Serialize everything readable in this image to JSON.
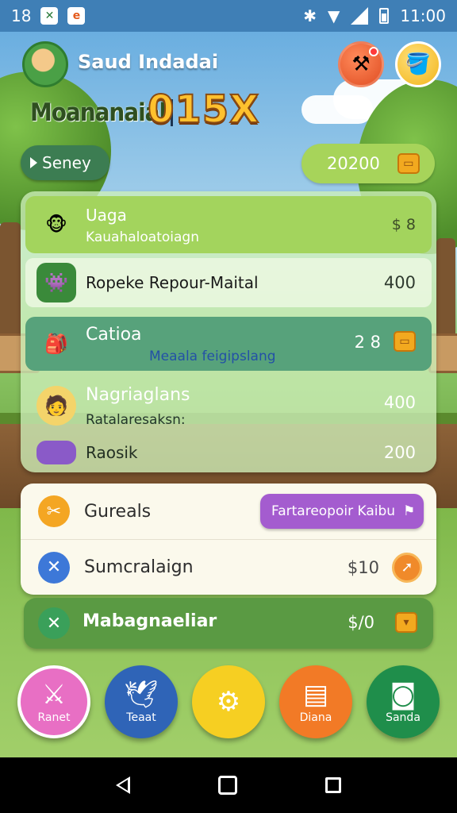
{
  "status_bar": {
    "left_text": "18",
    "time": "11:00"
  },
  "header": {
    "player_name": "Saud Indadai",
    "game_title": "Moananaial",
    "score": "015X",
    "season_label": "Seney",
    "coins": "20200"
  },
  "panel": {
    "rows": [
      {
        "title": "Uaga",
        "subtitle": "Kauahaloatoiagn",
        "amount": "$ 8"
      },
      {
        "title": "Ropeke Repour-Maital",
        "amount": "400"
      },
      {
        "title": "Catioa",
        "subtitle": "Meaala feigipslang",
        "amount": "2 8"
      },
      {
        "title": "Nagriaglans",
        "subtitle": "Ratalaresaksn:",
        "amount": "400"
      },
      {
        "title": "Raosik",
        "amount": "200"
      }
    ]
  },
  "menu": {
    "item1_label": "Gureals",
    "item1_action": "Fartareopoir Kaibu",
    "item2_label": "Sumcralaign",
    "item2_amount": "$10",
    "item3_label": "Mabagnaeliar",
    "item3_amount": "$/0"
  },
  "nav": [
    {
      "label": "Ranet",
      "icon": "swords-icon"
    },
    {
      "label": "Teaat",
      "icon": "bird-icon"
    },
    {
      "label": "",
      "icon": "gear-icon"
    },
    {
      "label": "Diana",
      "icon": "chat-icon"
    },
    {
      "label": "Sanda",
      "icon": "camera-icon"
    }
  ],
  "colors": {
    "accent_green": "#a3d45d",
    "coin": "#f2a91f",
    "purple": "#a45ccf"
  }
}
